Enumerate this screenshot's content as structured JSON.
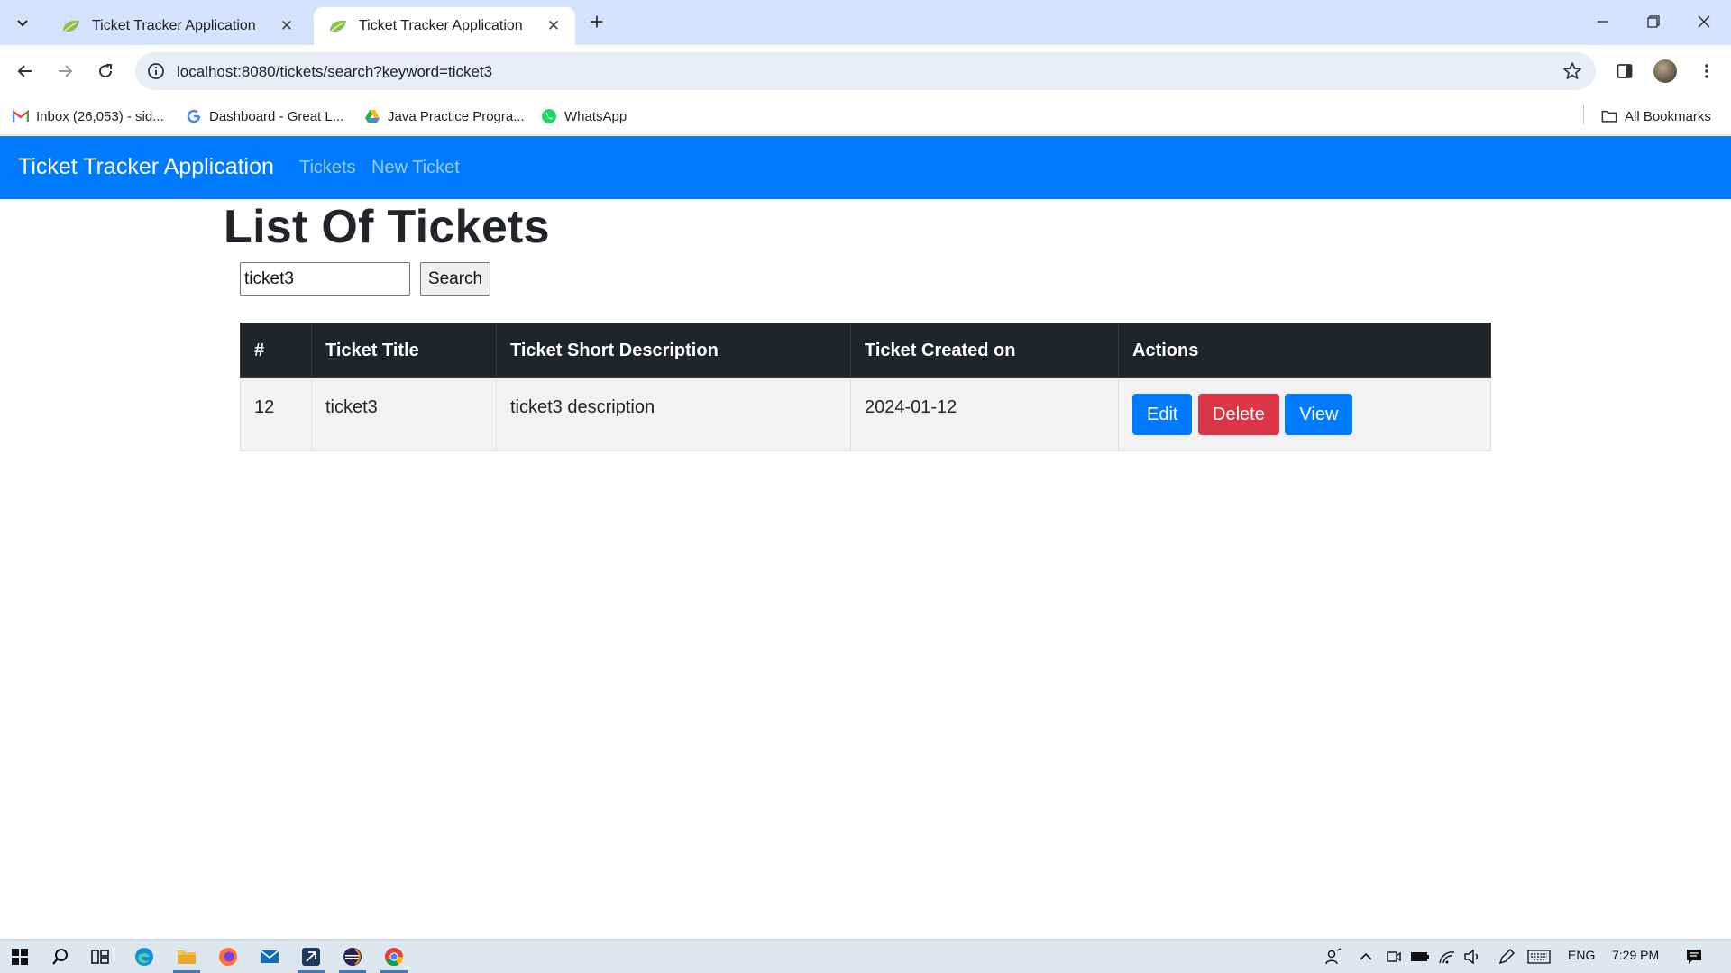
{
  "browser": {
    "tabs": [
      {
        "title": "Ticket Tracker Application",
        "active": false
      },
      {
        "title": "Ticket Tracker Application",
        "active": true
      }
    ],
    "new_tab": "+",
    "close_glyph": "✕",
    "url": "localhost:8080/tickets/search?keyword=ticket3",
    "bookmarks": [
      {
        "label": "Inbox (26,053) - sid...",
        "icon": "gmail-icon"
      },
      {
        "label": "Dashboard - Great L...",
        "icon": "google-icon"
      },
      {
        "label": "Java Practice Progra...",
        "icon": "google-drive-icon"
      },
      {
        "label": "WhatsApp",
        "icon": "whatsapp-icon"
      }
    ],
    "all_bookmarks": "All Bookmarks"
  },
  "navbar": {
    "brand": "Ticket Tracker Application",
    "links": [
      "Tickets",
      "New Ticket"
    ]
  },
  "page": {
    "title": "List Of Tickets",
    "search": {
      "value": "ticket3",
      "button": "Search"
    }
  },
  "table": {
    "columns": [
      "#",
      "Ticket Title",
      "Ticket Short Description",
      "Ticket Created on",
      "Actions"
    ],
    "rows": [
      {
        "id": "12",
        "title": "ticket3",
        "description": "ticket3 description",
        "created": "2024-01-12",
        "actions": {
          "edit": "Edit",
          "delete": "Delete",
          "view": "View"
        }
      }
    ]
  },
  "taskbar": {
    "lang": "ENG",
    "time": "7:29 PM"
  },
  "colors": {
    "navbar": "#007bff",
    "table_header": "#212529",
    "primary": "#007bff",
    "danger": "#dc3545",
    "tabstrip": "#d3e3fd"
  }
}
